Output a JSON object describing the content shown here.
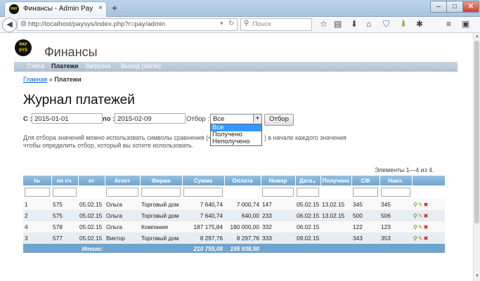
{
  "browser": {
    "tab_title": "Финансы - Admin Pay",
    "tab_close": "×",
    "new_tab": "+",
    "favicon_text": "PAY",
    "window_min": "–",
    "window_max": "□",
    "window_close": "✕",
    "url": "http://localhost/paysys/index.php?r=pay/admin",
    "search_placeholder": "Поиск",
    "toolbar_icons": [
      "star-icon",
      "clipboard-icon",
      "download-icon",
      "home-icon",
      "shield-icon",
      "download-arrow-icon",
      "puzzle-icon",
      "menu-icon",
      "sidebar-icon"
    ]
  },
  "site": {
    "logo_top": "PAY",
    "logo_bottom": "SYS",
    "title": "Финансы"
  },
  "menu": {
    "items": [
      "Счета",
      "Платежи",
      "Загрузка",
      "Выход (denis)"
    ],
    "active_index": 1
  },
  "breadcrumb": {
    "home": "Главная",
    "separator": "»",
    "current": "Платежи"
  },
  "heading": "Журнал платежей",
  "filter": {
    "from_label": "С :",
    "from_value": "2015-01-01",
    "to_label": "по :",
    "to_value": "2015-02-09",
    "select_label": "Отбор :",
    "select_value": "Все",
    "options": [
      "Все",
      "Получено",
      "Неполучено"
    ],
    "button": "Отбор"
  },
  "hint": {
    "line1": "Для отбора значений можно использовать символы сравнения (<",
    "line1_end": ") в начале каждого значения",
    "line2": "чтобы определить отбор, который вы хотите использовать."
  },
  "summary": "Элементы 1—4 из 4.",
  "grid": {
    "columns": [
      "№",
      "по сч.",
      "от",
      "Агент",
      "Фирма",
      "Сумма",
      "Оплата",
      "Номер",
      "Дата",
      "Получено",
      "СФ",
      "Накл.",
      ""
    ],
    "sort_column": "Дата",
    "sort_symbol": "▲",
    "rows": [
      {
        "n": "1",
        "inv": "575",
        "from": "05.02.15",
        "agent": "Ольга",
        "firm": "Торговый дом",
        "sum": "7 640,74",
        "paid": "7 000,74",
        "num": "147",
        "date": "05.02.15",
        "recv": "13.02.15",
        "sf": "345",
        "nakl": "345"
      },
      {
        "n": "2",
        "inv": "575",
        "from": "05.02.15",
        "agent": "Ольга",
        "firm": "Торговый дом",
        "sum": "7 640,74",
        "paid": "640,00",
        "num": "233",
        "date": "06.02.15",
        "recv": "13.02.15",
        "sf": "500",
        "nakl": "506"
      },
      {
        "n": "4",
        "inv": "578",
        "from": "05.02.15",
        "agent": "Ольга",
        "firm": "Компания",
        "sum": "187 175,84",
        "paid": "180 000,00",
        "num": "332",
        "date": "06.02.15",
        "recv": "",
        "sf": "122",
        "nakl": "123"
      },
      {
        "n": "3",
        "inv": "577",
        "from": "05.02.15",
        "agent": "Виктор",
        "firm": "Торговый дом",
        "sum": "8 297,76",
        "paid": "8 297,76",
        "num": "333",
        "date": "09.02.15",
        "recv": "",
        "sf": "343",
        "nakl": "353"
      }
    ],
    "total_label": "Итого:",
    "total_sum": "210 755,08",
    "total_paid": "195 938,50",
    "action_icons": {
      "view": "⚲",
      "edit": "✎",
      "delete": "✖"
    }
  }
}
